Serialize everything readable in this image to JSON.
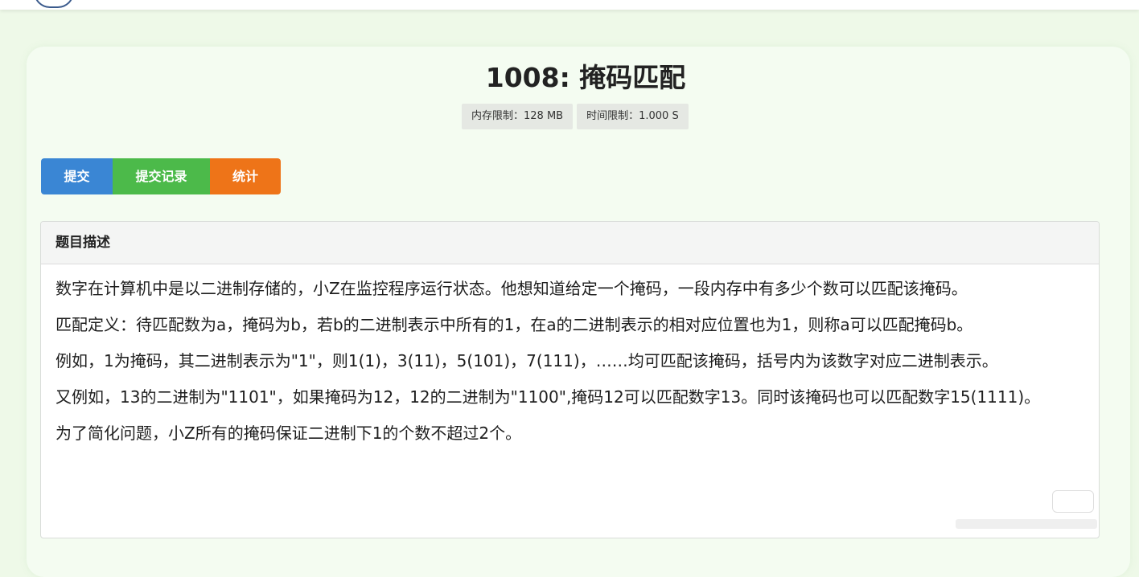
{
  "problem": {
    "title": "1008: 掩码匹配",
    "memory_limit": "内存限制：128 MB",
    "time_limit": "时间限制：1.000 S"
  },
  "actions": {
    "submit": "提交",
    "records": "提交记录",
    "stats": "统计"
  },
  "description": {
    "header": "题目描述",
    "paragraphs": [
      "数字在计算机中是以二进制存储的，小Z在监控程序运行状态。他想知道给定一个掩码，一段内存中有多少个数可以匹配该掩码。",
      "匹配定义：待匹配数为a，掩码为b，若b的二进制表示中所有的1，在a的二进制表示的相对应位置也为1，则称a可以匹配掩码b。",
      "例如，1为掩码，其二进制表示为\"1\"，则1(1)，3(11)，5(101)，7(111)，……均可匹配该掩码，括号内为该数字对应二进制表示。",
      "又例如，13的二进制为\"1101\"，如果掩码为12，12的二进制为\"1100\",掩码12可以匹配数字13。同时该掩码也可以匹配数字15(1111)。",
      "为了简化问题，小Z所有的掩码保证二进制下1的个数不超过2个。"
    ]
  },
  "colors": {
    "page_background": "#eef9e8",
    "submit_button": "#3a86d4",
    "records_button": "#4cba4a",
    "stats_button": "#ee7418"
  }
}
